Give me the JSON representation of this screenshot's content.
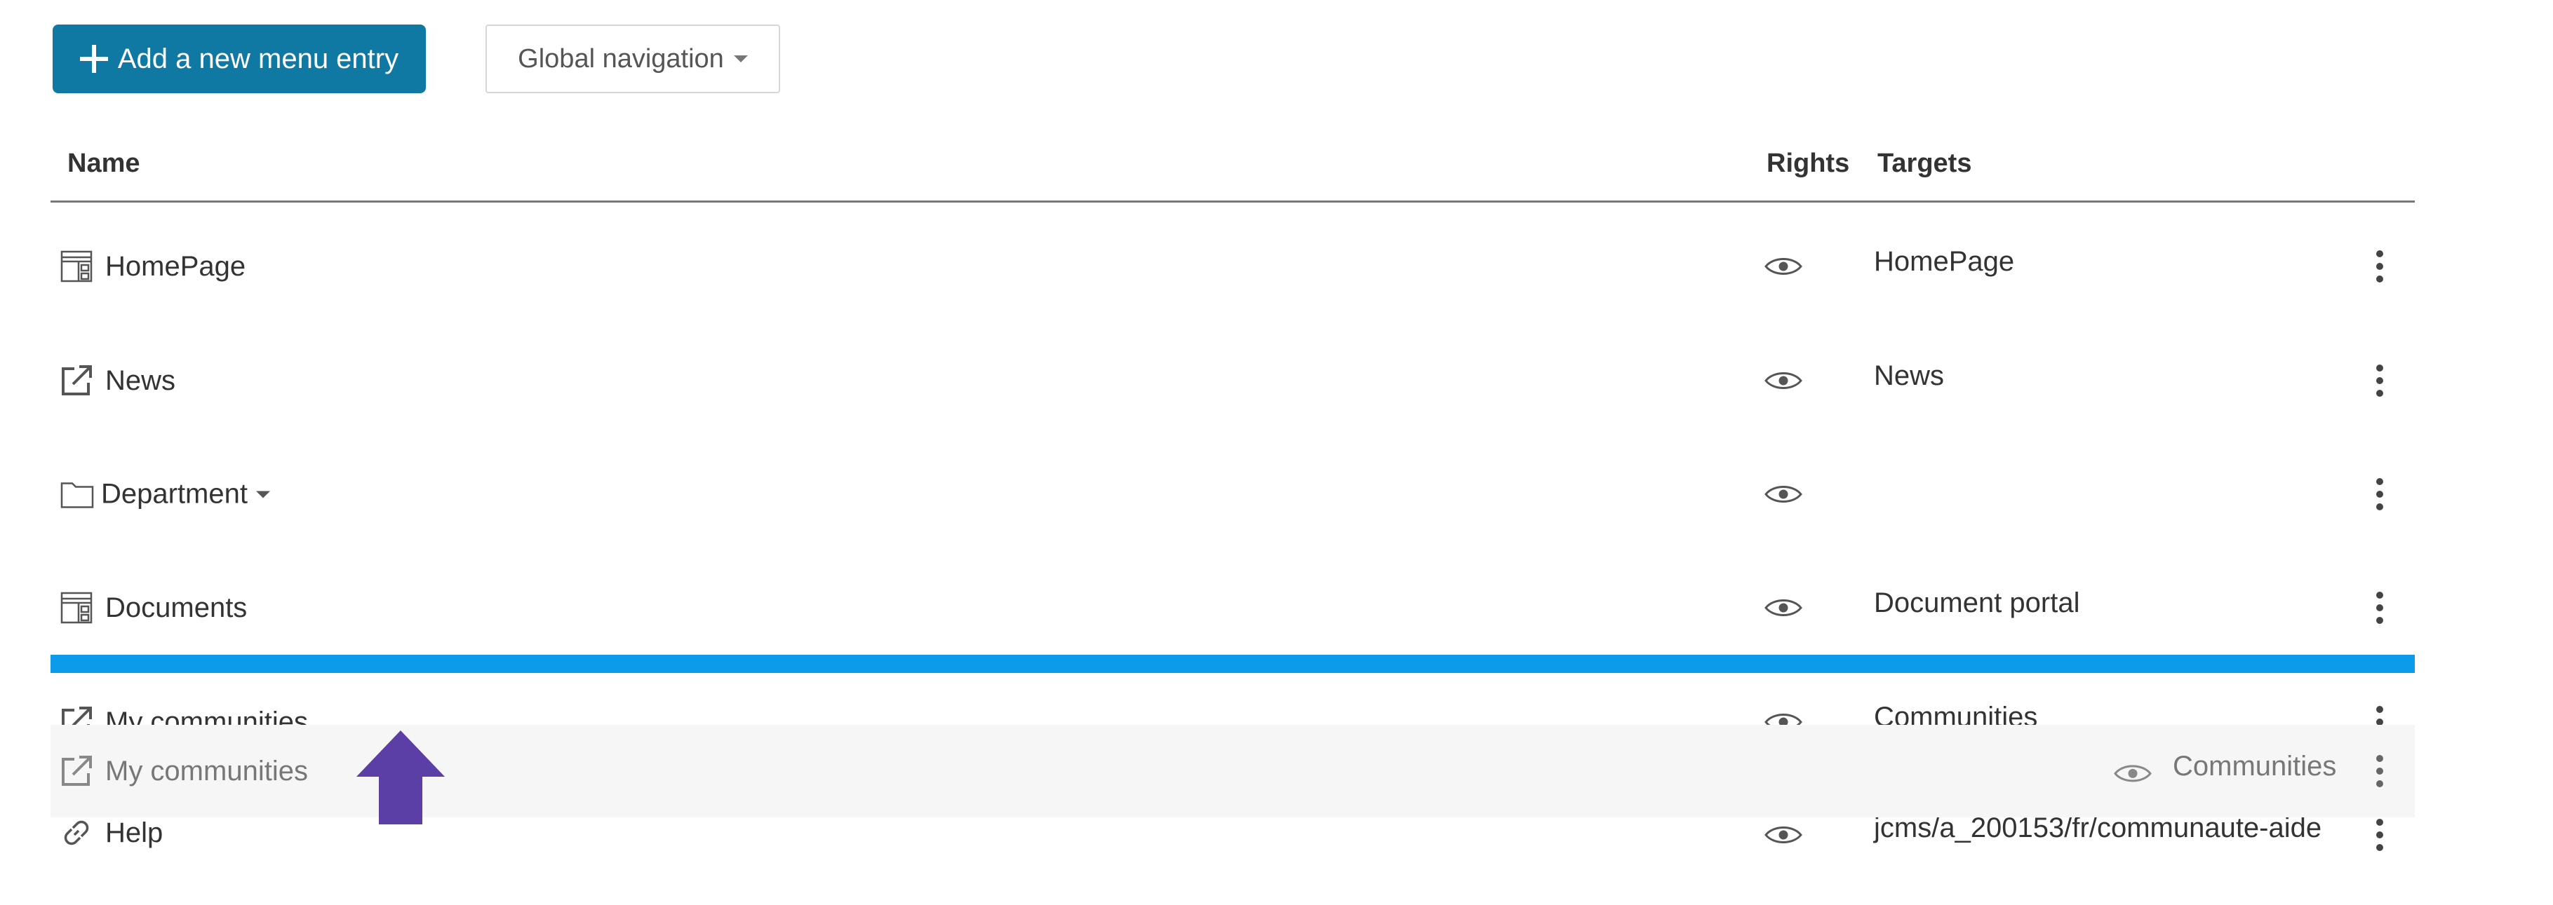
{
  "toolbar": {
    "add_label": "Add a new menu entry",
    "nav_select_value": "Global navigation"
  },
  "table": {
    "columns": {
      "name": "Name",
      "rights": "Rights",
      "targets": "Targets"
    },
    "rows": [
      {
        "name": "HomePage",
        "icon": "portal-icon",
        "target": "HomePage"
      },
      {
        "name": "News",
        "icon": "external-link-icon",
        "target": "News"
      },
      {
        "name": "Department",
        "icon": "folder-icon",
        "target": "",
        "has_dropdown": true
      },
      {
        "name": "Documents",
        "icon": "portal-icon",
        "target": "Document portal"
      },
      {
        "name": "My communities",
        "icon": "external-link-icon",
        "target": "Communities"
      },
      {
        "name": "Help",
        "icon": "link-icon",
        "target": "jcms/a_200153/fr/communaute-aide"
      }
    ],
    "dragged_row": {
      "name": "My communities",
      "icon": "external-link-icon",
      "target": "Communities"
    }
  },
  "colors": {
    "primary_button": "#0f79a4",
    "drop_indicator": "#0b9bea",
    "drag_cursor": "#5b3ea6"
  }
}
